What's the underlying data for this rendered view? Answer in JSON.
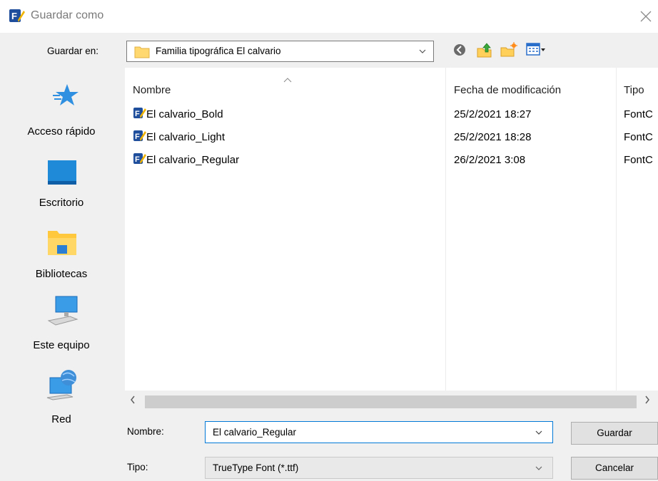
{
  "window": {
    "title": "Guardar como"
  },
  "save_in": {
    "label": "Guardar en:",
    "value": "Familia tipográfica El calvario"
  },
  "toolbar": {
    "icons": [
      "back-icon",
      "up-folder-icon",
      "new-folder-icon",
      "view-menu-icon"
    ]
  },
  "places": [
    {
      "label": "Acceso rápido",
      "icon": "quick-access-star-icon"
    },
    {
      "label": "Escritorio",
      "icon": "desktop-icon"
    },
    {
      "label": "Bibliotecas",
      "icon": "libraries-icon"
    },
    {
      "label": "Este equipo",
      "icon": "this-pc-icon"
    },
    {
      "label": "Red",
      "icon": "network-icon"
    }
  ],
  "file_list": {
    "columns": [
      "Nombre",
      "Fecha de modificación",
      "Tipo"
    ],
    "rows": [
      {
        "name": "El calvario_Bold",
        "date": "25/2/2021 18:27",
        "type": "FontC"
      },
      {
        "name": "El calvario_Light",
        "date": "25/2/2021 18:28",
        "type": "FontC"
      },
      {
        "name": "El calvario_Regular",
        "date": "26/2/2021 3:08",
        "type": "FontC"
      }
    ]
  },
  "filename": {
    "label": "Nombre:",
    "value": "El calvario_Regular"
  },
  "filetype": {
    "label": "Tipo:",
    "value": "TrueType Font (*.ttf)"
  },
  "buttons": {
    "save": "Guardar",
    "cancel": "Cancelar"
  },
  "colors": {
    "accent": "#0078d7",
    "list_bg": "#ffffff",
    "dialog_bg": "#f0f0f0"
  }
}
